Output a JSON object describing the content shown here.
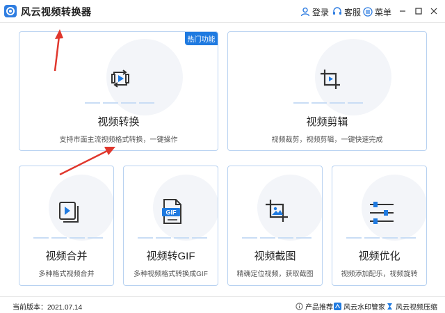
{
  "window": {
    "title": "风云视频转换器"
  },
  "header": {
    "login_label": "登录",
    "service_label": "客服",
    "menu_label": "菜单"
  },
  "cards": {
    "convert": {
      "title": "视频转换",
      "desc": "支持市面主流视频格式转换，一键操作",
      "badge": "热门功能",
      "icon": "video-convert-icon"
    },
    "cut": {
      "title": "视频剪辑",
      "desc": "视频裁剪，视频剪辑，一键快速完成",
      "icon": "crop-icon"
    },
    "merge": {
      "title": "视频合并",
      "desc": "多种格式视频合并",
      "icon": "video-merge-icon"
    },
    "gif": {
      "title": "视频转GIF",
      "desc": "多种视频格式转换成GIF",
      "icon": "gif-file-icon",
      "icon_text": "GIF"
    },
    "screenshot": {
      "title": "视频截图",
      "desc": "精确定位视频，获取截图",
      "icon": "crop-image-icon"
    },
    "optimize": {
      "title": "视频优化",
      "desc": "视频添加配乐，视频旋转",
      "icon": "sliders-icon"
    }
  },
  "footer": {
    "version": "当前版本：2021.07.14",
    "recommend_label": "产品推荐：",
    "product1": "风云水印管家",
    "product2": "风云视频压缩"
  },
  "colors": {
    "accent": "#1f7ae0",
    "card_border": "#b8d2f1",
    "arrow_red": "#e0372d"
  }
}
